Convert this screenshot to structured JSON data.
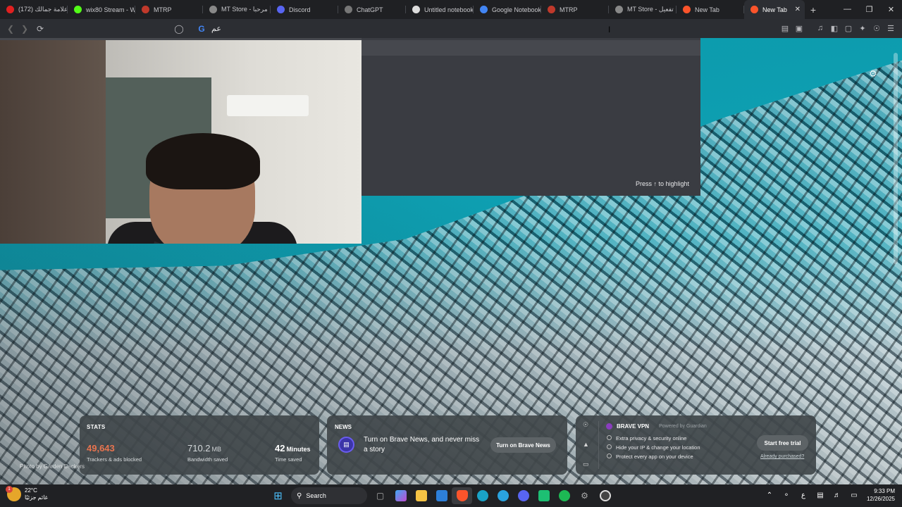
{
  "tabs": [
    {
      "title": "(172) علامة جمالك",
      "icon": "youtube-icon",
      "color": "#e02020"
    },
    {
      "title": "wix80 Stream - W",
      "icon": "kick-icon",
      "color": "#53fc18"
    },
    {
      "title": "MTRP",
      "icon": "mtrp-icon",
      "color": "#c0392b"
    },
    {
      "title": "MT Store - مرحبا",
      "icon": "globe-icon",
      "color": "#888888"
    },
    {
      "title": "Discord",
      "icon": "discord-icon",
      "color": "#5865f2"
    },
    {
      "title": "ChatGPT",
      "icon": "chatgpt-icon",
      "color": "#777777"
    },
    {
      "title": "Untitled notebook",
      "icon": "notebook-icon",
      "color": "#dddddd"
    },
    {
      "title": "Google Notebook",
      "icon": "google-icon",
      "color": "#4285f4"
    },
    {
      "title": "MTRP",
      "icon": "mtrp-icon",
      "color": "#c0392b"
    },
    {
      "title": "MT Store - تفعيل",
      "icon": "globe-icon",
      "color": "#888888"
    },
    {
      "title": "New Tab",
      "icon": "brave-icon",
      "color": "#fb542b"
    },
    {
      "title": "New Tab",
      "icon": "brave-icon",
      "color": "#fb542b",
      "active": true
    }
  ],
  "omnibox": {
    "text": "عم"
  },
  "omnibox_popup": {
    "hint": "Press ↑ to highlight"
  },
  "stats": {
    "header": "STATS",
    "trackers": {
      "value": "49,643",
      "label": "Trackers & ads blocked",
      "color": "#e8744f"
    },
    "bandwidth": {
      "value": "710.2",
      "unit": "MB",
      "label": "Bandwidth saved"
    },
    "time": {
      "value": "42",
      "unit": "Minutes",
      "label": "Time saved"
    }
  },
  "news": {
    "header": "NEWS",
    "text": "Turn on Brave News, and never miss a story",
    "button": "Turn on Brave News"
  },
  "vpn": {
    "title": "BRAVE VPN",
    "powered": "Powered by Guardian",
    "items": [
      "Extra privacy & security online",
      "Hide your IP & change your location",
      "Protect every app on your device"
    ],
    "button": "Start free trial",
    "link": "Already purchased?"
  },
  "photo_credit": "Photo by Garden Deckers",
  "taskbar": {
    "weather_temp": "22°C",
    "weather_desc": "غائم جزئيًا",
    "search": "Search",
    "time": "9:33 PM",
    "date": "12/26/2025",
    "lang": "ع"
  }
}
